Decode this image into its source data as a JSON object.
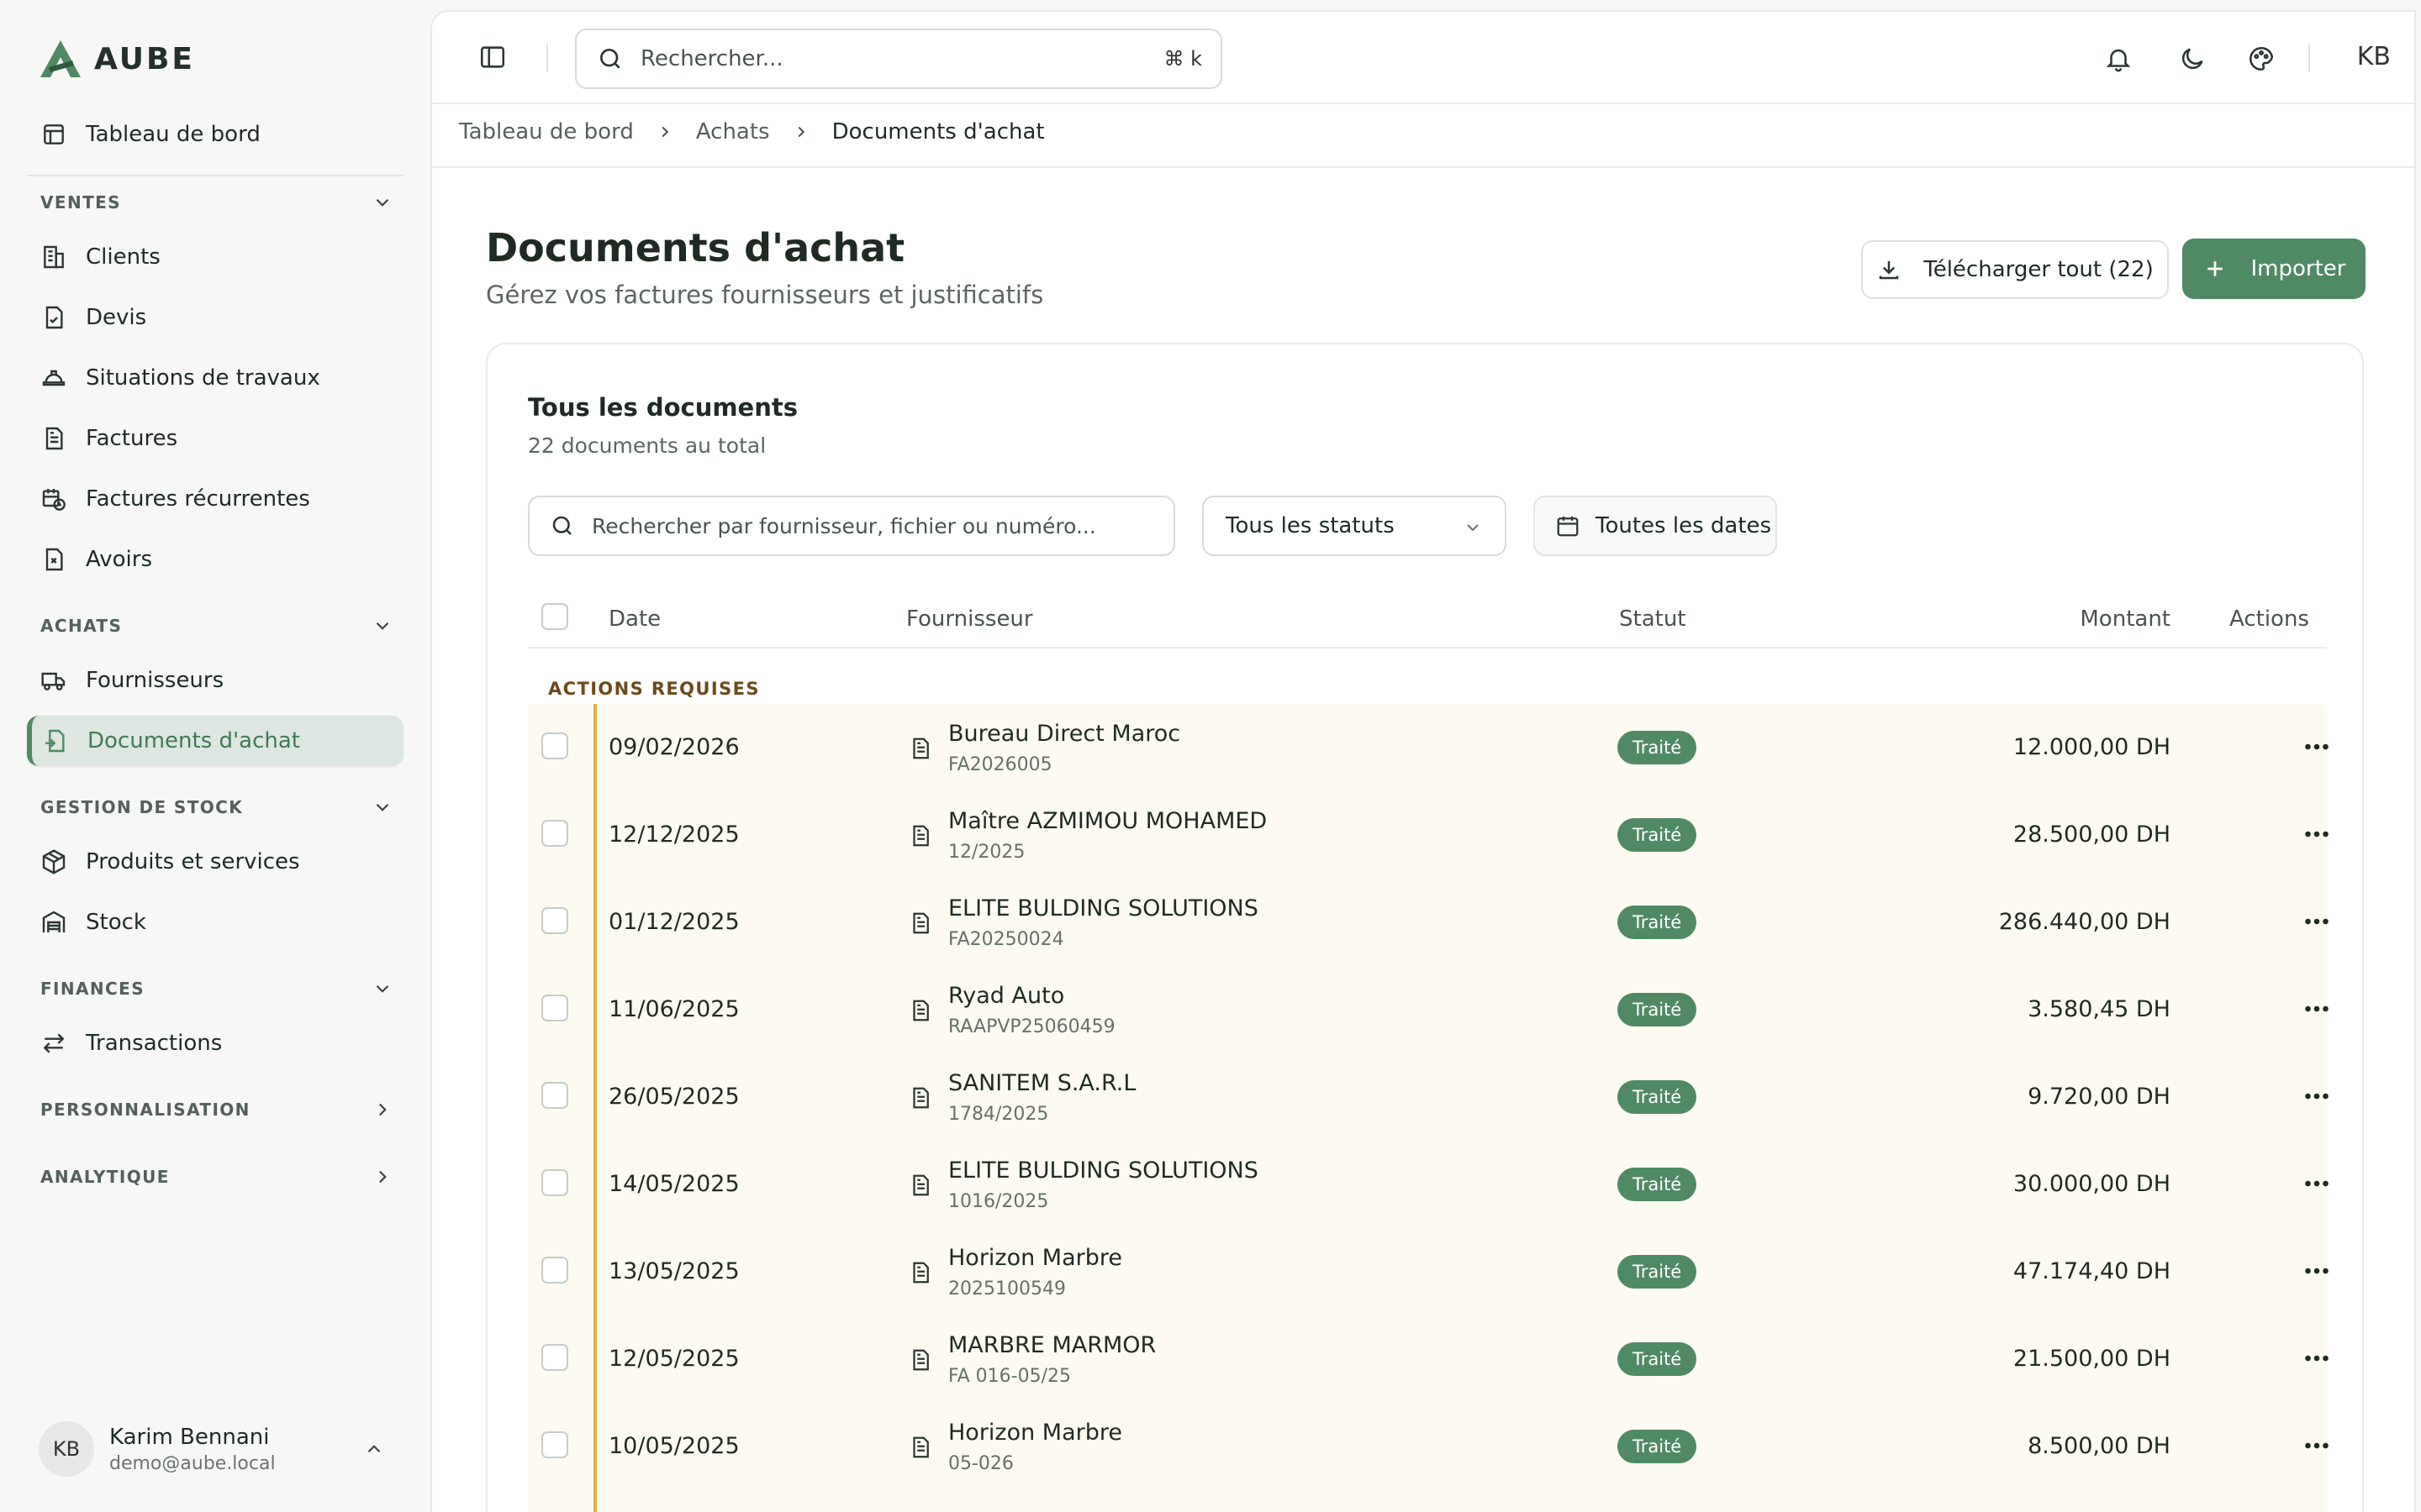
{
  "app": {
    "name": "AUBE",
    "accent": "#4f8a64"
  },
  "sidebar": {
    "dashboard": {
      "label": "Tableau de bord",
      "icon": "dashboard-icon"
    },
    "sections": {
      "ventes": {
        "label": "VENTES",
        "items": [
          {
            "label": "Clients",
            "icon": "building-icon"
          },
          {
            "label": "Devis",
            "icon": "quote-icon"
          },
          {
            "label": "Situations de travaux",
            "icon": "hardhat-icon"
          },
          {
            "label": "Factures",
            "icon": "invoice-icon"
          },
          {
            "label": "Factures récurrentes",
            "icon": "calendar-clock-icon"
          },
          {
            "label": "Avoirs",
            "icon": "credit-note-icon"
          }
        ]
      },
      "achats": {
        "label": "ACHATS",
        "items": [
          {
            "label": "Fournisseurs",
            "icon": "truck-icon"
          },
          {
            "label": "Documents d'achat",
            "icon": "document-import-icon"
          }
        ]
      },
      "stock": {
        "label": "GESTION DE STOCK",
        "items": [
          {
            "label": "Produits et services",
            "icon": "package-icon"
          },
          {
            "label": "Stock",
            "icon": "warehouse-icon"
          }
        ]
      },
      "finances": {
        "label": "FINANCES",
        "items": [
          {
            "label": "Transactions",
            "icon": "arrows-swap-icon"
          }
        ]
      },
      "perso": {
        "label": "PERSONNALISATION"
      },
      "analytique": {
        "label": "ANALYTIQUE"
      }
    },
    "user": {
      "initials": "KB",
      "name": "Karim Bennani",
      "email": "demo@aube.local"
    }
  },
  "topbar": {
    "search_placeholder": "Rechercher...",
    "shortcut": "⌘ k",
    "user_initials": "KB"
  },
  "breadcrumb": [
    "Tableau de bord",
    "Achats",
    "Documents d'achat"
  ],
  "page": {
    "title": "Documents d'achat",
    "subtitle": "Gérez vos factures fournisseurs et justificatifs",
    "download_all": "Télécharger tout (22)",
    "import": "Importer"
  },
  "card": {
    "title": "Tous les documents",
    "subtitle": "22 documents au total",
    "search_placeholder": "Rechercher par fournisseur, fichier ou numéro...",
    "status_filter": "Tous les statuts",
    "date_filter": "Toutes les dates"
  },
  "table": {
    "headers": {
      "date": "Date",
      "supplier": "Fournisseur",
      "status": "Statut",
      "amount": "Montant",
      "actions": "Actions"
    },
    "group": "ACTIONS REQUISES",
    "rows": [
      {
        "date": "09/02/2026",
        "supplier": "Bureau Direct Maroc",
        "ref": "FA2026005",
        "status": "Traité",
        "amount": "12.000,00 DH"
      },
      {
        "date": "12/12/2025",
        "supplier": "Maître AZMIMOU MOHAMED",
        "ref": "12/2025",
        "status": "Traité",
        "amount": "28.500,00 DH"
      },
      {
        "date": "01/12/2025",
        "supplier": "ELITE BULDING SOLUTIONS",
        "ref": "FA20250024",
        "status": "Traité",
        "amount": "286.440,00 DH"
      },
      {
        "date": "11/06/2025",
        "supplier": "Ryad Auto",
        "ref": "RAAPVP25060459",
        "status": "Traité",
        "amount": "3.580,45 DH"
      },
      {
        "date": "26/05/2025",
        "supplier": "SANITEM S.A.R.L",
        "ref": "1784/2025",
        "status": "Traité",
        "amount": "9.720,00 DH"
      },
      {
        "date": "14/05/2025",
        "supplier": "ELITE BULDING SOLUTIONS",
        "ref": "1016/2025",
        "status": "Traité",
        "amount": "30.000,00 DH"
      },
      {
        "date": "13/05/2025",
        "supplier": "Horizon Marbre",
        "ref": "2025100549",
        "status": "Traité",
        "amount": "47.174,40 DH"
      },
      {
        "date": "12/05/2025",
        "supplier": "MARBRE MARMOR",
        "ref": "FA 016-05/25",
        "status": "Traité",
        "amount": "21.500,00 DH"
      },
      {
        "date": "10/05/2025",
        "supplier": "Horizon Marbre",
        "ref": "05-026",
        "status": "Traité",
        "amount": "8.500,00 DH"
      }
    ]
  }
}
